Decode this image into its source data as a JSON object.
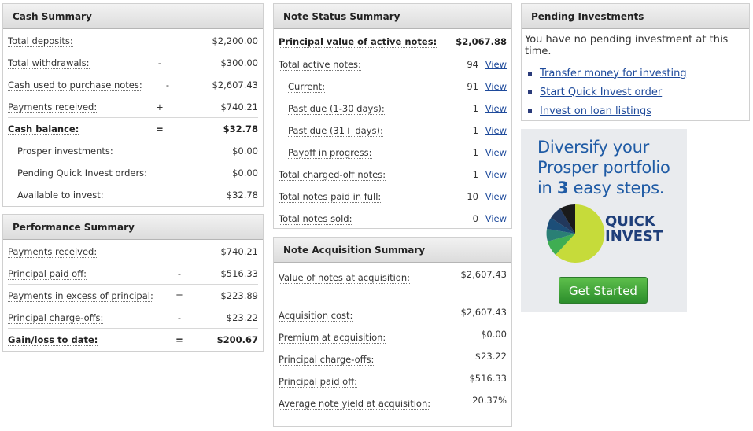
{
  "cash_summary": {
    "title": "Cash Summary",
    "rows": [
      {
        "label": "Total deposits:",
        "op": "",
        "value": "$2,200.00"
      },
      {
        "label": "Total withdrawals:",
        "op": "-",
        "value": "$300.00"
      },
      {
        "label": "Cash used to purchase notes:",
        "op": "-",
        "value": "$2,607.43"
      },
      {
        "label": "Payments received:",
        "op": "+",
        "value": "$740.21"
      },
      {
        "label": "Cash balance:",
        "op": "=",
        "value": "$32.78"
      },
      {
        "label": "Prosper investments:",
        "op": "",
        "value": "$0.00"
      },
      {
        "label": "Pending Quick Invest orders:",
        "op": "",
        "value": "$0.00"
      },
      {
        "label": "Available to invest:",
        "op": "",
        "value": "$32.78"
      }
    ]
  },
  "performance_summary": {
    "title": "Performance Summary",
    "rows": [
      {
        "label": "Payments received:",
        "op": "",
        "value": "$740.21"
      },
      {
        "label": "Principal paid off:",
        "op": "-",
        "value": "$516.33"
      },
      {
        "label": "Payments in excess of principal:",
        "op": "=",
        "value": "$223.89"
      },
      {
        "label": "Principal charge-offs:",
        "op": "-",
        "value": "$23.22"
      },
      {
        "label": "Gain/loss to date:",
        "op": "=",
        "value": "$200.67"
      }
    ]
  },
  "note_status_summary": {
    "title": "Note Status Summary",
    "principal_label": "Principal value of active notes:",
    "principal_value": "$2,067.88",
    "view_label": "View",
    "rows": [
      {
        "label": "Total active notes:",
        "value": "94"
      },
      {
        "label": "Current:",
        "value": "91"
      },
      {
        "label": "Past due (1-30 days):",
        "value": "1"
      },
      {
        "label": "Past due (31+ days):",
        "value": "1"
      },
      {
        "label": "Payoff in progress:",
        "value": "1"
      },
      {
        "label": "Total charged-off notes:",
        "value": "1"
      },
      {
        "label": "Total notes paid in full:",
        "value": "10"
      },
      {
        "label": "Total notes sold:",
        "value": "0"
      }
    ]
  },
  "note_acquisition_summary": {
    "title": "Note Acquisition Summary",
    "rows": [
      {
        "label": "Value of notes at acquisition:",
        "value": "$2,607.43"
      },
      {
        "label": "Acquisition cost:",
        "value": "$2,607.43"
      },
      {
        "label": "Premium at acquisition:",
        "value": "$0.00"
      },
      {
        "label": "Principal charge-offs:",
        "value": "$23.22"
      },
      {
        "label": "Principal paid off:",
        "value": "$516.33"
      },
      {
        "label": "Average note yield at acquisition:",
        "value": "20.37%"
      }
    ]
  },
  "pending_investments": {
    "title": "Pending Investments",
    "message": "You have no pending investment at this time.",
    "links": [
      "Transfer money for investing",
      "Start Quick Invest order",
      "Invest on loan listings"
    ]
  },
  "ad": {
    "line1": "Diversify your",
    "line2": "Prosper portfolio",
    "line3_pre": "in ",
    "line3_num": "3",
    "line3_post": " easy steps.",
    "brand_line1": "QUICK",
    "brand_line2": "INVEST",
    "button": "Get Started",
    "colors": {
      "title": "#1f5ba5",
      "button": "#3fa53a",
      "pie_main": "#c8dc3c"
    }
  }
}
